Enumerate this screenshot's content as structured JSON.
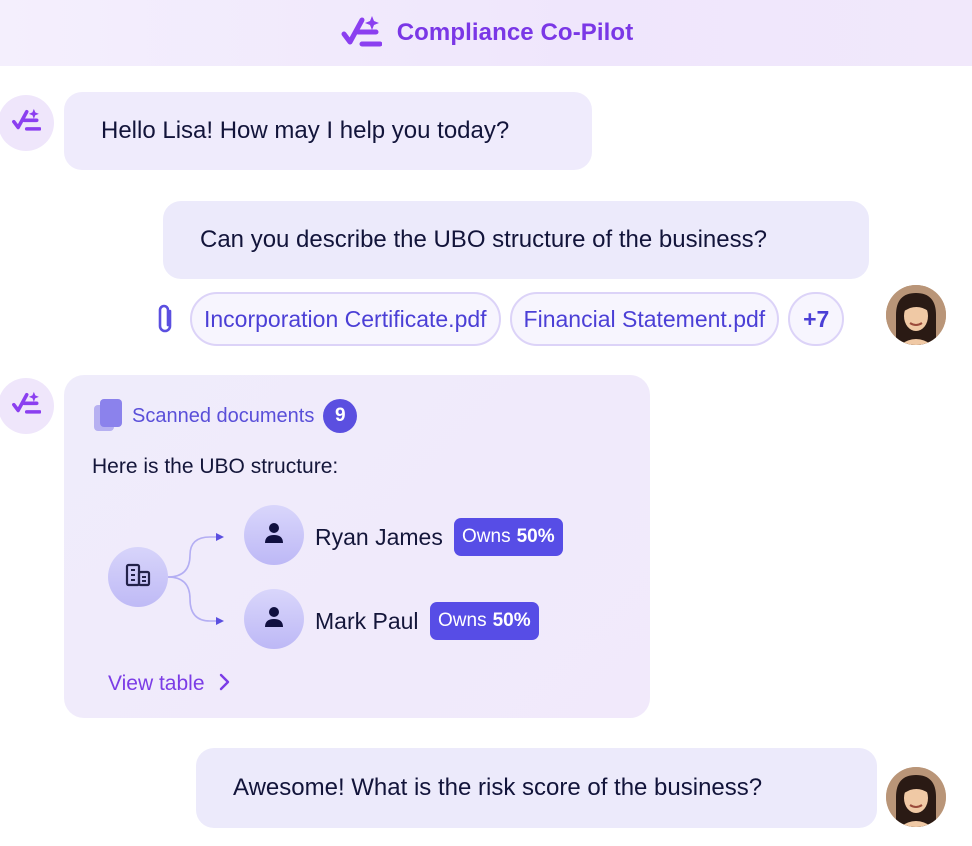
{
  "header": {
    "title": "Compliance Co-Pilot",
    "logo_icon": "copilot-logo-icon"
  },
  "colors": {
    "brand": "#7a37e6",
    "accent": "#5b4fe0",
    "bubble": "#eceafb"
  },
  "messages": {
    "bot_greeting": "Hello Lisa! How may I help you today?",
    "user_question": "Can you describe the UBO structure of the business?",
    "user_followup": "Awesome! What is the risk score of the business?"
  },
  "attachments": {
    "items": [
      "Incorporation Certificate.pdf",
      "Financial Statement.pdf"
    ],
    "more_label": "+7"
  },
  "ubo_card": {
    "scanned_label": "Scanned documents",
    "scanned_count": "9",
    "intro": "Here is the UBO structure:",
    "owners": [
      {
        "name": "Ryan James",
        "owns_label": "Owns",
        "owns_value": "50%"
      },
      {
        "name": "Mark Paul",
        "owns_label": "Owns",
        "owns_value": "50%"
      }
    ],
    "view_table_label": "View table"
  }
}
